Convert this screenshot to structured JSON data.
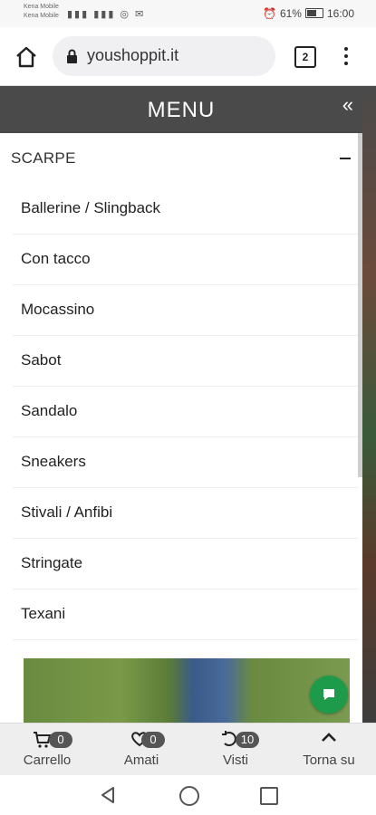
{
  "status_bar": {
    "carrier_line1": "Kena Mobile",
    "carrier_line2": "Kena Mobile",
    "battery": "61%",
    "time": "16:00"
  },
  "browser": {
    "url": "youshoppit.it",
    "tab_count": "2"
  },
  "menu": {
    "title": "MENU",
    "close_glyph": "«",
    "category": {
      "label": "SCARPE",
      "expanded": true
    },
    "items": [
      {
        "label": "Ballerine / Slingback"
      },
      {
        "label": "Con tacco"
      },
      {
        "label": "Mocassino"
      },
      {
        "label": "Sabot"
      },
      {
        "label": "Sandalo"
      },
      {
        "label": "Sneakers"
      },
      {
        "label": "Stivali / Anfibi"
      },
      {
        "label": "Stringate"
      },
      {
        "label": "Texani"
      }
    ]
  },
  "bottom_nav": {
    "cart": {
      "label": "Carrello",
      "count": "0"
    },
    "loved": {
      "label": "Amati",
      "count": "0"
    },
    "viewed": {
      "label": "Visti",
      "count": "10"
    },
    "top": {
      "label": "Torna su"
    }
  },
  "colors": {
    "menu_header": "#4a4a4a",
    "chat_button": "#1e9b4a",
    "bottom_nav_bg": "#eeeeee"
  }
}
